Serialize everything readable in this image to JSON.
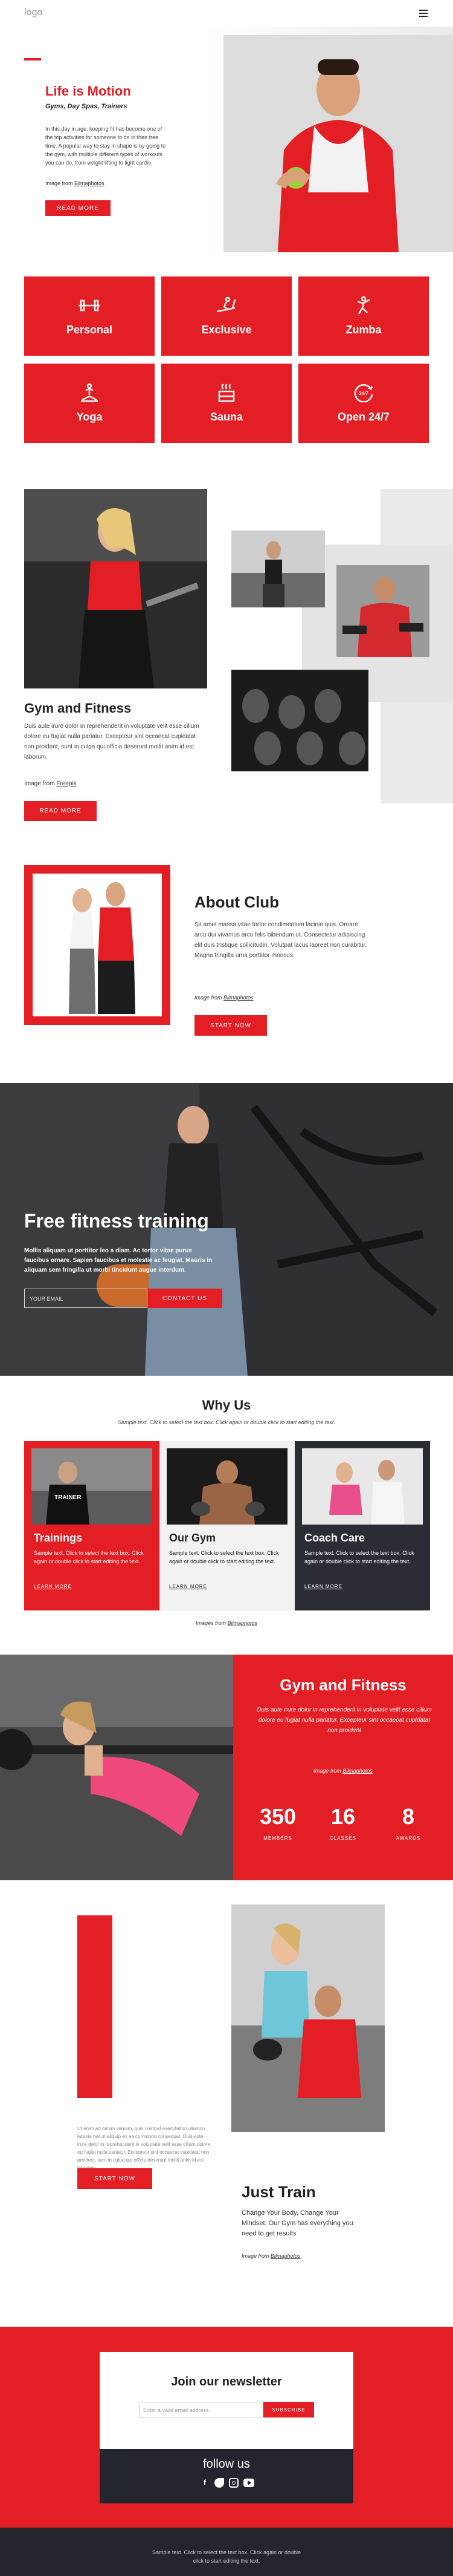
{
  "header": {
    "logo": "logo",
    "menu_icon": "hamburger-icon"
  },
  "hero": {
    "title": "Life is Motion",
    "subtitle": "Gyms, Day Spas, Trainers",
    "text": "In this day in age, keeping fit has become one of the top activities for someone to do in their free time. A popular way to stay in shape is by going to the gym, with multiple different types of workouts you can do, from weight lifting to light cardio.",
    "credit_prefix": "Image from",
    "credit_link": "Bilmaphotos",
    "button": "READ MORE"
  },
  "services": [
    {
      "label": "Personal",
      "icon": "dumbbell-icon"
    },
    {
      "label": "Exclusive",
      "icon": "treadmill-icon"
    },
    {
      "label": "Zumba",
      "icon": "dancer-icon"
    },
    {
      "label": "Yoga",
      "icon": "yoga-icon"
    },
    {
      "label": "Sauna",
      "icon": "sauna-icon"
    },
    {
      "label": "Open 24/7",
      "icon": "clock-247-icon"
    }
  ],
  "gym": {
    "title": "Gym and Fitness",
    "text": "Duis aute irure dolor in reprehenderit in voluptate velit esse cillum dolore eu fugiat nulla pariatur. Excepteur sint occaecat cupidatat non proident, sunt in culpa qui officia deserunt mollit anim id est laborum.",
    "credit_prefix": "Image from",
    "credit_link": "Freepik",
    "button": "READ MORE"
  },
  "about": {
    "title": "About Club",
    "text": "Sit amet massa vitae tortor condimentum lacinia quis. Ornare arcu dui vivamus arcu felis bibendum ut. Consectetur adipiscing elit duis tristique sollicitudin. Volutpat lacus laoreet non curabitur. Magna fringilla urna porttitor rhoncus.",
    "credit_prefix": "Image from",
    "credit_link": "Bilmaphotos",
    "button": "START NOW"
  },
  "free": {
    "title": "Free fitness training",
    "text": "Mollis aliquam ut porttitor leo a diam. Ac tortor vitae purus faucibus ornare. Sapien faucibus et molestie ac feugiat. Mauris in aliquam sem fringilla ut morbi tincidunt augue interdum.",
    "email_placeholder": "YOUR EMAIL",
    "button": "CONTACT US"
  },
  "why": {
    "title": "Why Us",
    "subtitle": "Sample text. Click to select the text box. Click again or double click to start editing the text.",
    "cards": [
      {
        "title": "Trainings",
        "text": "Sample text. Click to select the text box. Click again or double click to start editing the text.",
        "more": "LEARN MORE"
      },
      {
        "title": "Our Gym",
        "text": "Sample text. Click to select the text box. Click again or double click to start editing the text.",
        "more": "LEARN MORE"
      },
      {
        "title": "Coach Care",
        "text": "Sample text. Click to select the text box. Click again or double click to start editing the text.",
        "more": "LEARN MORE"
      }
    ],
    "credit_prefix": "Images from",
    "credit_link": "Bilmaphotos"
  },
  "stats": {
    "title": "Gym and Fitness",
    "text": "Duis aute irure dolor in reprehenderit in voluptate velit esse cillum dolore eu fugiat nulla pariatur. Excepteur sint occaecat cupidatat non proident",
    "credit_prefix": "Image from",
    "credit_link": "Bilmaphotos",
    "items": [
      {
        "value": "350",
        "label": "MEMBERS"
      },
      {
        "value": "16",
        "label": "CLASSES"
      },
      {
        "value": "8",
        "label": "AWARDS"
      }
    ]
  },
  "train": {
    "side_text": "Ut enim ad minim veniam, quis nostrud exercitation ullamco laboris nisi ut aliquip ex ea commodo consequat. Duis aute irure dolor in reprehenderit in voluptate velit esse cillum dolore eu fugiat nulla pariatur. Excepteur sint occaecat cupidatat non proident, sunt in culpa qui officia deserunt mollit anim id est laborum.",
    "button": "START NOW",
    "title": "Just Train",
    "text": "Change Your Body, Change Your Mindset. Our Gym has everything you need to get results",
    "credit_prefix": "Image from",
    "credit_link": "Bilmaphotos"
  },
  "newsletter": {
    "title": "Join our newsletter",
    "placeholder": "Enter a valid email address",
    "button": "SUBSCRIBE",
    "follow": "follow us"
  },
  "footer": {
    "text": "Sample text. Click to select the text box. Click again or double click to start editing the text."
  },
  "colors": {
    "accent": "#e31e24",
    "dark": "#23262d"
  }
}
